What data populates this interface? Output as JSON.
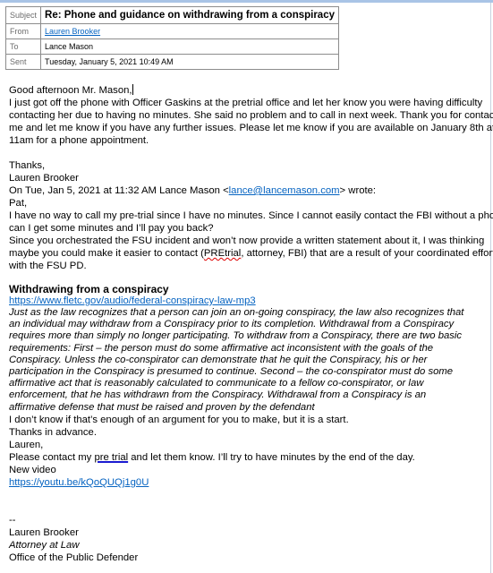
{
  "header": {
    "subject_label": "Subject",
    "subject": "Re: Phone and guidance on withdrawing from a conspiracy",
    "from_label": "From",
    "from": "Lauren Brooker",
    "to_label": "To",
    "to": "Lance Mason",
    "sent_label": "Sent",
    "sent": "Tuesday, January 5, 2021 10:49 AM"
  },
  "reply": {
    "greeting": "Good afternoon Mr. Mason,",
    "lines": [
      "I just got off the phone with Officer Gaskins at the pretrial office and let her know you were having difficulty",
      "contacting her due to having no minutes. She said no problem and to call in next week. Thank you for contacting",
      "me and let me know if you have any further issues. Please let me know if you are available on January 8th at",
      "11am for a phone appointment."
    ],
    "thanks": "Thanks,",
    "name": "Lauren Brooker"
  },
  "quoted": {
    "intro_pre": "On Tue, Jan 5, 2021 at 11:32 AM Lance Mason <",
    "email": "lance@lancemason.com",
    "intro_post": "> wrote:",
    "salutation": "Pat,",
    "p1": [
      "I have no way to call my pre-trial since I have no minutes. Since I cannot easily contact the FBI without a phone,",
      "can I get some minutes and I’ll pay you back?"
    ],
    "p2_line1": "Since you orchestrated the FSU incident and won’t now provide a written statement about it, I was thinking",
    "p2_line2_pre": "maybe you could make it easier to contact (",
    "p2_line2_squiggle": "PREtrial",
    "p2_line2_post": ", attorney, FBI) that are a result of your coordinated efforts",
    "p2_line3": "with the FSU PD.",
    "heading": "Withdrawing from a conspiracy",
    "heading_link": "https://www.fletc.gov/audio/federal-conspiracy-law-mp3",
    "excerpt": [
      "Just as the law recognizes that a person can join an on-going conspiracy, the law also recognizes that",
      "an individual may withdraw from a Conspiracy prior to its completion. Withdrawal from a Conspiracy",
      "requires more than simply no longer participating. To withdraw from a Conspiracy, there are two basic",
      "requirements: First – the person must do some affirmative act inconsistent with the goals of the",
      "Conspiracy. Unless the co-conspirator can demonstrate that he quit the Conspiracy, his or her",
      "participation in the Conspiracy is presumed to continue. Second – the co-conspirator must do some",
      "affirmative act that is reasonably calculated to communicate to a fellow co-conspirator, or law",
      "enforcement, that he has withdrawn from the Conspiracy. Withdrawal from a Conspiracy is an",
      "affirmative defense that must be raised and proven by the defendant"
    ],
    "after_excerpt": "I don’t know if that’s enough of an argument for you to make, but it is a start.",
    "thanks_advance": "Thanks in advance.",
    "salutation2": "Lauren,",
    "please_pre": "Please contact my ",
    "please_ul": "pre trial",
    "please_post": " and let them know. I’ll try to have minutes by the end of the day.",
    "new_video": "New video",
    "video_link": "https://youtu.be/kQoQUQj1g0U"
  },
  "signature": {
    "dashes": "--",
    "name": "Lauren Brooker",
    "title": "Attorney at Law",
    "office": "Office of the Public Defender"
  },
  "colors": {
    "link": "#0563c1",
    "top_bar": "#a9c4e6"
  }
}
